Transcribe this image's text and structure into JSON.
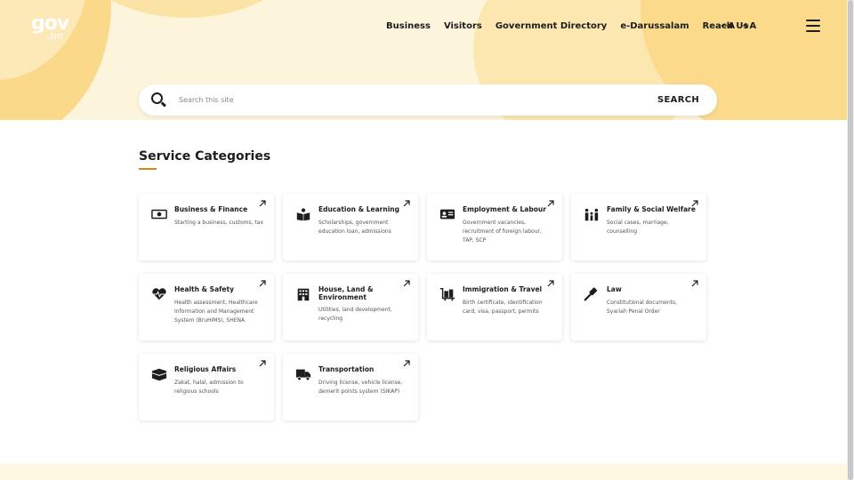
{
  "logo": {
    "main": "gov",
    "sub": ".bn"
  },
  "nav": [
    "Business",
    "Visitors",
    "Government Directory",
    "e-Darussalam",
    "Reach Us"
  ],
  "font_controls": {
    "decrease": "−A",
    "increase": "+A"
  },
  "search": {
    "placeholder": "Search this site",
    "button": "SEARCH"
  },
  "section_title": "Service Categories",
  "categories": [
    {
      "title": "Business & Finance",
      "desc": "Starting a business, customs, tax",
      "icon": "money-bill-icon"
    },
    {
      "title": "Education & Learning",
      "desc": "Scholarships, government education loan, admissions",
      "icon": "book-reader-icon"
    },
    {
      "title": "Employment & Labour",
      "desc": "Government vacancies, recruitment of foreign labour, TAP, SCP",
      "icon": "id-card-icon"
    },
    {
      "title": "Family & Social Welfare",
      "desc": "Social cases, marriage, counselling",
      "icon": "family-icon"
    },
    {
      "title": "Health & Safety",
      "desc": "Health assessment, Healthcare Information and Management System (BruHIMS), SHENA",
      "icon": "heartbeat-icon"
    },
    {
      "title": "House, Land & Environment",
      "desc": "Utilities, land development, recycling",
      "icon": "building-icon"
    },
    {
      "title": "Immigration & Travel",
      "desc": "Birth certificate, identification card, visa, passport, permits",
      "icon": "luggage-cart-icon"
    },
    {
      "title": "Law",
      "desc": "Constitutional documents, Syariah Penal Order",
      "icon": "gavel-icon"
    },
    {
      "title": "Religious Affairs",
      "desc": "Zakat, halal, admission to religious schools",
      "icon": "kaaba-icon"
    },
    {
      "title": "Transportation",
      "desc": "Driving license, vehicle license, demerit points system (SIKAP)",
      "icon": "truck-icon"
    }
  ],
  "colors": {
    "accent": "#d48a1a",
    "hero_bg": "#fdf4dc",
    "hero_blob": "#fbd98b"
  }
}
